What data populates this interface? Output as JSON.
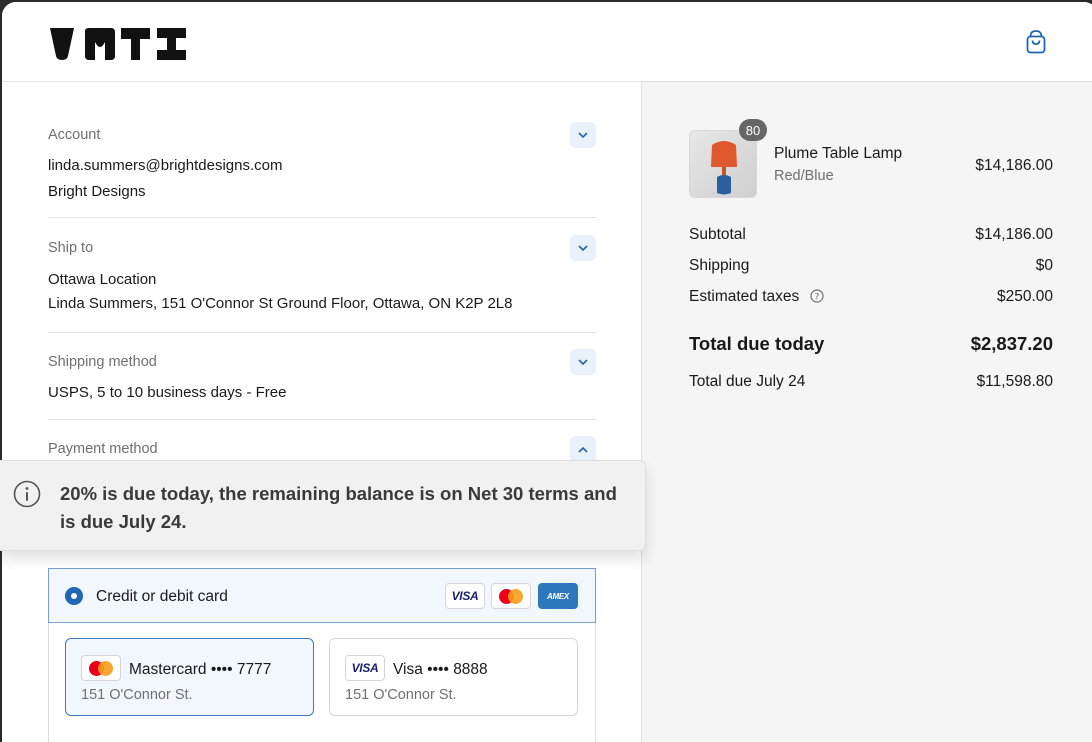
{
  "header": {
    "logo_text": "VNTI"
  },
  "account": {
    "label": "Account",
    "email": "linda.summers@brightdesigns.com",
    "company": "Bright Designs"
  },
  "ship_to": {
    "label": "Ship to",
    "location": "Ottawa Location",
    "address": "Linda Summers, 151 O'Connor St Ground Floor, Ottawa, ON K2P 2L8"
  },
  "shipping_method": {
    "label": "Shipping method",
    "value": "USPS, 5 to 10 business days - Free"
  },
  "payment_method": {
    "label": "Payment method",
    "option_label": "Credit or debit card",
    "accepted_logos": [
      "visa",
      "mastercard",
      "amex"
    ]
  },
  "notice": {
    "icon": "info-icon",
    "text": "20% is due today, the remaining balance is on Net 30 terms and is due July 24."
  },
  "saved_cards": [
    {
      "brand": "mastercard",
      "label": "Mastercard •••• 7777",
      "address": "151 O'Connor St.",
      "selected": true
    },
    {
      "brand": "visa",
      "label": "Visa •••• 8888",
      "address": "151 O'Connor St.",
      "selected": false
    }
  ],
  "summary": {
    "product": {
      "name": "Plume Table Lamp",
      "variant": "Red/Blue",
      "price": "$14,186.00",
      "quantity": "80"
    },
    "subtotal": {
      "label": "Subtotal",
      "value": "$14,186.00"
    },
    "shipping": {
      "label": "Shipping",
      "value": "$0"
    },
    "taxes": {
      "label": "Estimated taxes",
      "value": "$250.00"
    },
    "total_today": {
      "label": "Total due today",
      "value": "$2,837.20"
    },
    "total_later": {
      "label": "Total due July 24",
      "value": "$11,598.80"
    }
  },
  "colors": {
    "accent": "#1f67b2",
    "text": "#1a1a1a",
    "muted": "#707070",
    "panel": "#f5f5f5"
  }
}
